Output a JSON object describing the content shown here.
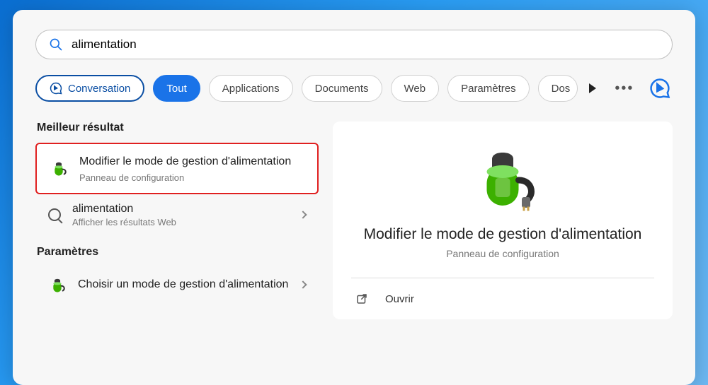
{
  "search": {
    "value": "alimentation"
  },
  "filters": {
    "conversation": "Conversation",
    "all": "Tout",
    "apps": "Applications",
    "docs": "Documents",
    "web": "Web",
    "params": "Paramètres",
    "folders_cut": "Dos"
  },
  "left": {
    "best_header": "Meilleur résultat",
    "best": {
      "title": "Modifier le mode de gestion d'alimentation",
      "sub": "Panneau de configuration"
    },
    "web": {
      "title": "alimentation",
      "sub": "Afficher les résultats Web"
    },
    "params_header": "Paramètres",
    "param1": {
      "title": "Choisir un mode de gestion d'alimentation"
    }
  },
  "right": {
    "title": "Modifier le mode de gestion d'alimentation",
    "sub": "Panneau de configuration",
    "open": "Ouvrir"
  }
}
